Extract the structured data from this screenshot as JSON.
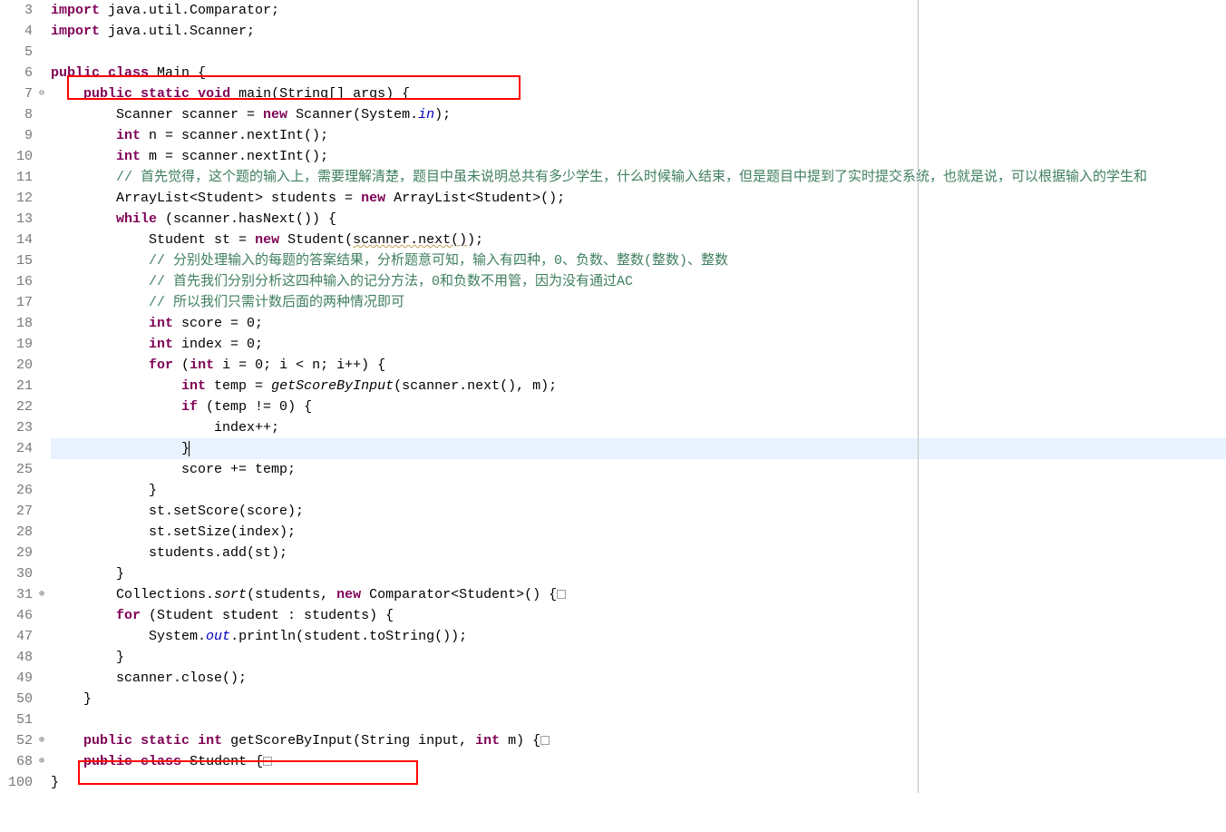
{
  "gutter": [
    "3",
    "4",
    "5",
    "6",
    "7",
    "8",
    "9",
    "10",
    "11",
    "12",
    "13",
    "14",
    "15",
    "16",
    "17",
    "18",
    "19",
    "20",
    "21",
    "22",
    "23",
    "24",
    "25",
    "26",
    "27",
    "28",
    "29",
    "30",
    "31",
    "46",
    "47",
    "48",
    "49",
    "50",
    "51",
    "52",
    "68",
    "100"
  ],
  "fold": [
    "",
    "",
    "",
    "",
    "⊖",
    "",
    "",
    "",
    "",
    "",
    "",
    "",
    "",
    "",
    "",
    "",
    "",
    "",
    "",
    "",
    "",
    "",
    "",
    "",
    "",
    "",
    "",
    "",
    "⊕",
    "",
    "",
    "",
    "",
    "",
    "",
    "⊕",
    "⊕",
    ""
  ],
  "tokens": {
    "l3": {
      "t1": "import",
      "t2": " java.util.Comparator;"
    },
    "l4": {
      "t1": "import",
      "t2": " java.util.Scanner;"
    },
    "l6": {
      "t1": "public",
      "t2": "class",
      "t3": " Main {"
    },
    "l7": {
      "t1": "public",
      "t2": "static",
      "t3": "void",
      "t4": " main(String[] args) {"
    },
    "l8": {
      "t1": "Scanner scanner = ",
      "t2": "new",
      "t3": " Scanner(System.",
      "t4": "in",
      "t5": ");"
    },
    "l9": {
      "t1": "int",
      "t2": " n = scanner.nextInt();"
    },
    "l10": {
      "t1": "int",
      "t2": " m = scanner.nextInt();"
    },
    "l11": {
      "t1": "// 首先觉得，这个题的输入上，需要理解清楚，题目中虽未说明总共有多少学生，什么时候输入结束，但是题目中提到了实时提交系统，也就是说，可以根据输入的学生和"
    },
    "l12": {
      "t1": "ArrayList<Student> students = ",
      "t2": "new",
      "t3": " ArrayList<Student>();"
    },
    "l13": {
      "t1": "while",
      "t2": " (scanner.hasNext()) {"
    },
    "l14": {
      "t1": "Student st = ",
      "t2": "new",
      "t3": " Student(",
      "t4": "scanner.next()",
      "t5": ");"
    },
    "l15": {
      "t1": "// 分别处理输入的每题的答案结果，分析题意可知，输入有四种，0、负数、整数(整数)、整数"
    },
    "l16": {
      "t1": "// 首先我们分别分析这四种输入的记分方法，0和负数不用管，因为没有通过AC"
    },
    "l17": {
      "t1": "// 所以我们只需计数后面的两种情况即可"
    },
    "l18": {
      "t1": "int",
      "t2": " score = 0;"
    },
    "l19": {
      "t1": "int",
      "t2": " index = 0;"
    },
    "l20": {
      "t1": "for",
      "t2": " (",
      "t3": "int",
      "t4": " i = 0; i < n; i++) {"
    },
    "l21": {
      "t1": "int",
      "t2": " temp = ",
      "t3": "getScoreByInput",
      "t4": "(scanner.next(), m);"
    },
    "l22": {
      "t1": "if",
      "t2": " (temp != 0) {"
    },
    "l23": {
      "t1": "index++;"
    },
    "l24": {
      "t1": "}"
    },
    "l25": {
      "t1": "score += temp;"
    },
    "l26": {
      "t1": "}"
    },
    "l27": {
      "t1": "st.setScore(score);"
    },
    "l28": {
      "t1": "st.setSize(index);"
    },
    "l29": {
      "t1": "students.add(st);"
    },
    "l30": {
      "t1": "}"
    },
    "l31": {
      "t1": "Collections.",
      "t2": "sort",
      "t3": "(students, ",
      "t4": "new",
      "t5": " Comparator<Student>() {"
    },
    "l46": {
      "t1": "for",
      "t2": " (Student student : students) {"
    },
    "l47": {
      "t1": "System.",
      "t2": "out",
      "t3": ".println(student.toString());"
    },
    "l48": {
      "t1": "}"
    },
    "l49": {
      "t1": "scanner.close();"
    },
    "l50": {
      "t1": "}"
    },
    "l52": {
      "t1": "public",
      "t2": "static",
      "t3": "int",
      "t4": " getScoreByInput(String input, ",
      "t5": "int",
      "t6": " m) {"
    },
    "l68": {
      "t1": "public",
      "t2": "class",
      "t3": " Student {"
    },
    "l100": {
      "t1": "}"
    }
  }
}
